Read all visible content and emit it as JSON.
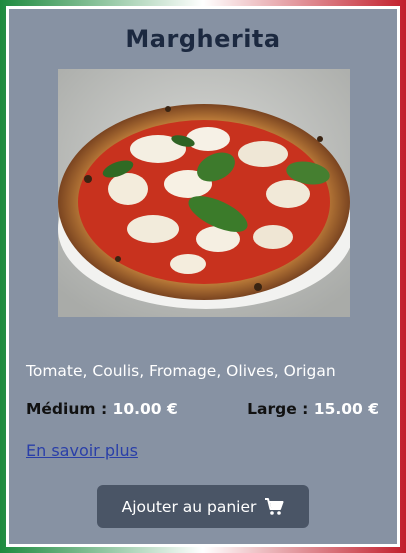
{
  "product": {
    "title": "Margherita",
    "image_icon": "pizza-photo",
    "ingredients": "Tomate, Coulis, Fromage, Olives, Origan",
    "prices": [
      {
        "size": "Médium",
        "separator": ":",
        "amount": "10.00 €"
      },
      {
        "size": "Large",
        "separator": ":",
        "amount": "15.00 €"
      }
    ],
    "more_link": "En savoir plus",
    "cart_button": "Ajouter au panier",
    "cart_icon": "shopping-cart-icon"
  },
  "colors": {
    "card_bg": "#8792a3",
    "title": "#1c2940",
    "button_bg": "#4a5566",
    "link": "#2a3fa8",
    "frame_green": "#1d8a3e",
    "frame_red": "#c21f2c"
  }
}
